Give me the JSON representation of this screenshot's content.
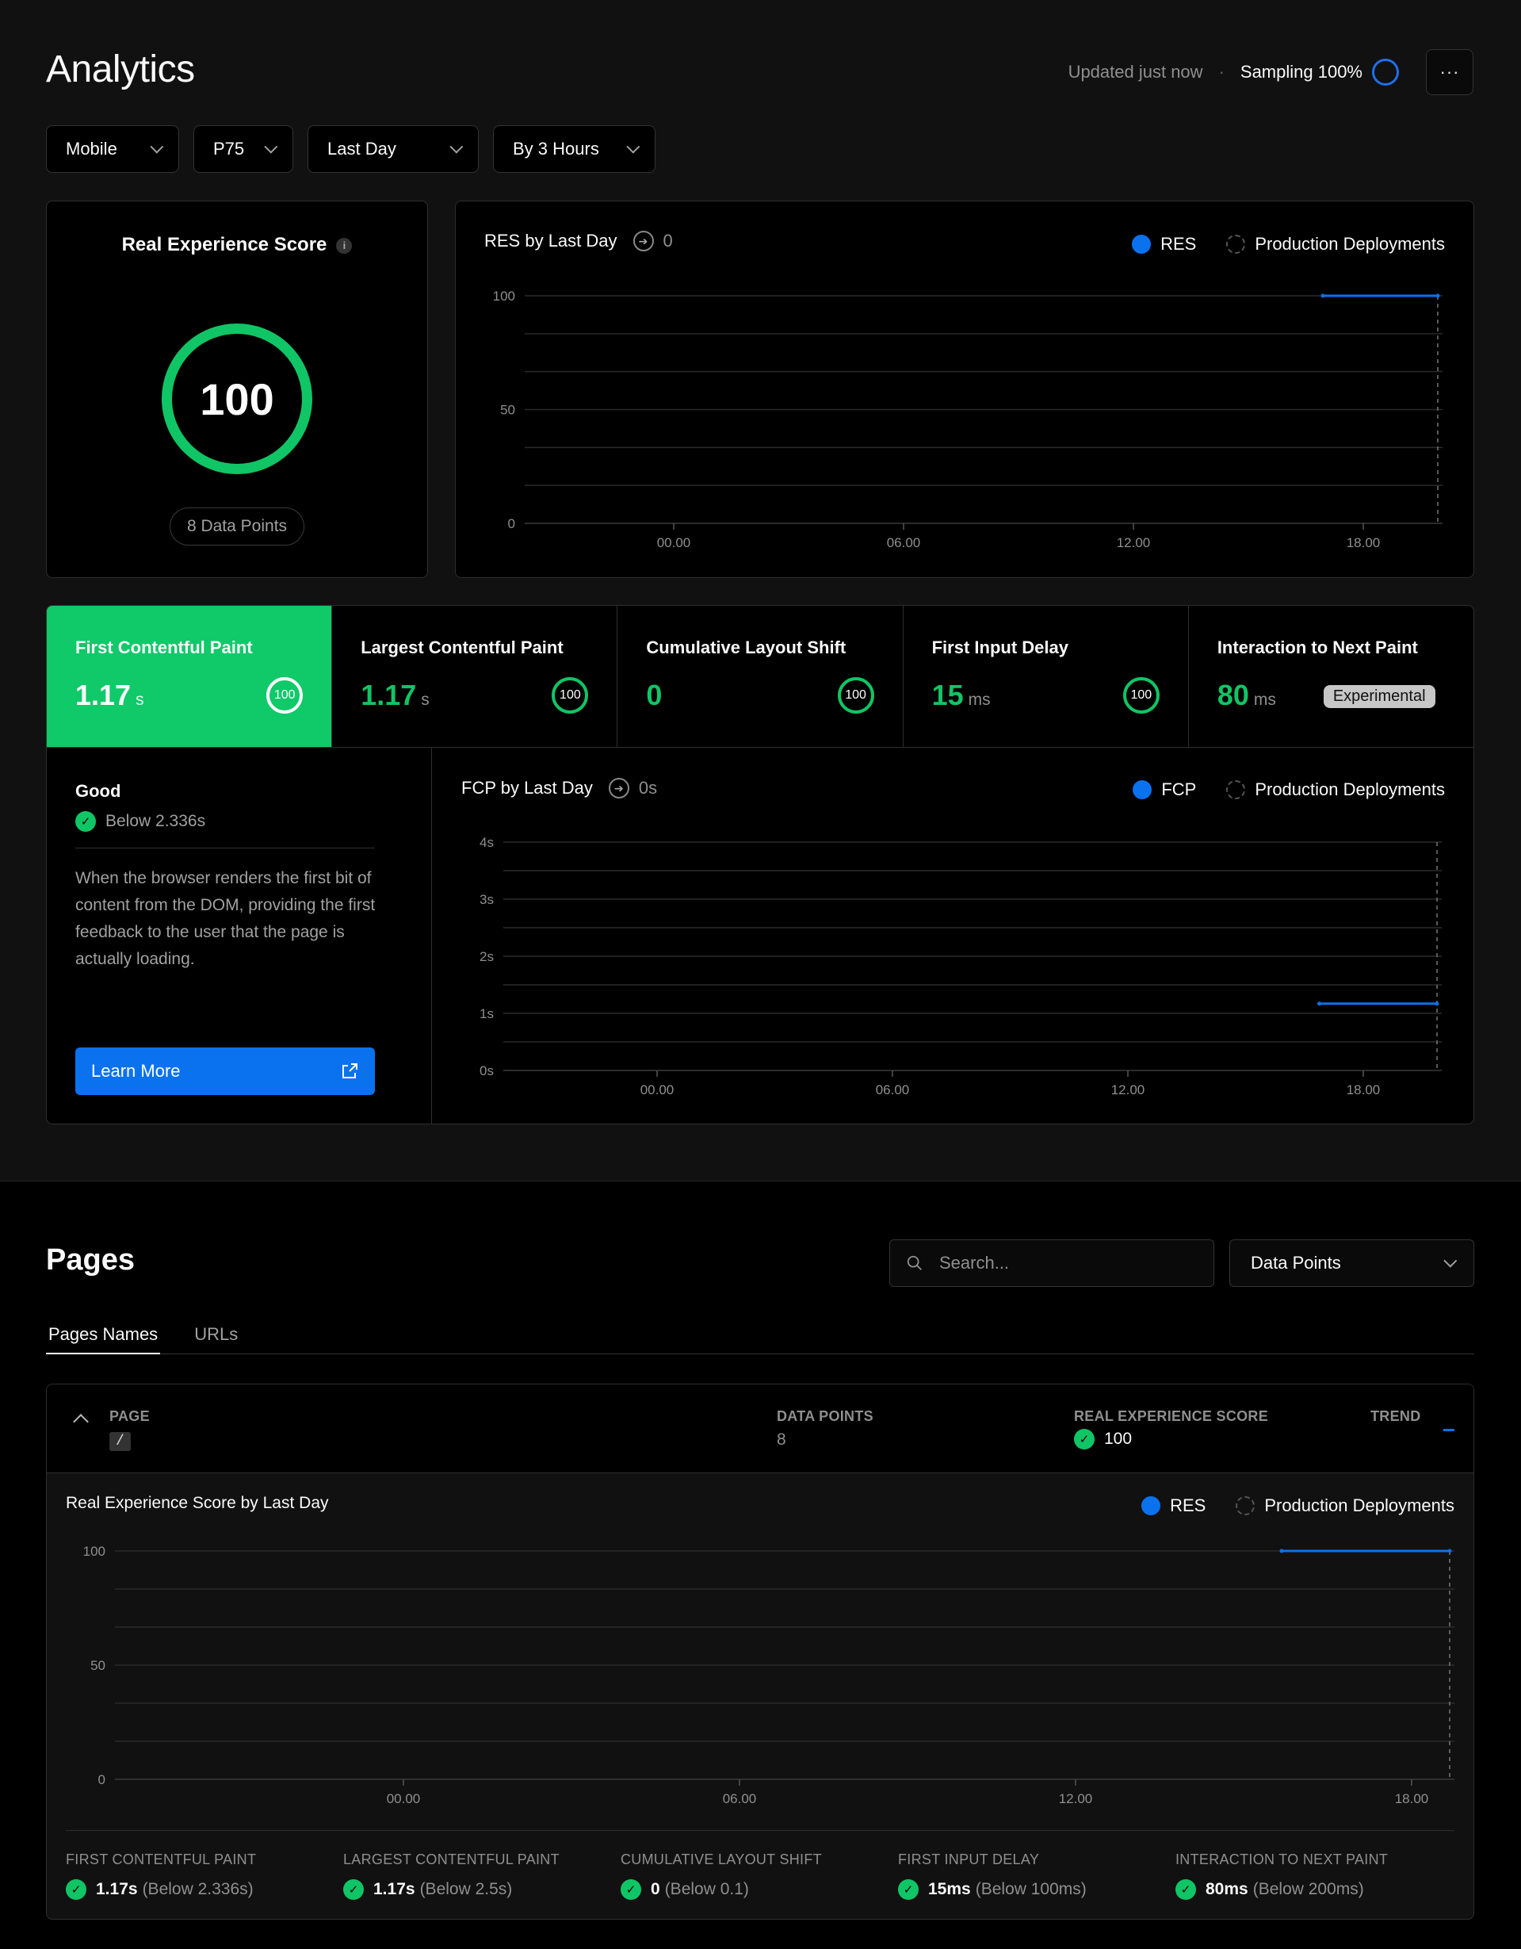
{
  "header": {
    "title": "Analytics",
    "updated": "Updated just now",
    "separator": "·",
    "sampling": "Sampling 100%",
    "more_label": "···"
  },
  "filters": [
    {
      "label": "Mobile"
    },
    {
      "label": "P75"
    },
    {
      "label": "Last Day"
    },
    {
      "label": "By 3 Hours"
    }
  ],
  "res_card": {
    "title": "Real Experience Score",
    "info_icon": "i",
    "score": "100",
    "data_points": "8 Data Points"
  },
  "res_chart": {
    "title": "RES by Last Day",
    "change": "0",
    "legend_primary": "RES",
    "legend_secondary": "Production Deployments"
  },
  "metrics": [
    {
      "name": "First Contentful Paint",
      "value": "1.17",
      "unit": "s",
      "score": "100",
      "active": true
    },
    {
      "name": "Largest Contentful Paint",
      "value": "1.17",
      "unit": "s",
      "score": "100"
    },
    {
      "name": "Cumulative Layout Shift",
      "value": "0",
      "unit": "",
      "score": "100"
    },
    {
      "name": "First Input Delay",
      "value": "15",
      "unit": "ms",
      "score": "100"
    },
    {
      "name": "Interaction to Next Paint",
      "value": "80",
      "unit": "ms",
      "badge": "Experimental"
    }
  ],
  "detail": {
    "rating": "Good",
    "threshold": "Below 2.336s",
    "description": "When the browser renders the first bit of content from the DOM, providing the first feedback to the user that the page is actually loading.",
    "learn_more": "Learn More"
  },
  "fcp_chart": {
    "title": "FCP by Last Day",
    "change": "0s",
    "legend_primary": "FCP",
    "legend_secondary": "Production Deployments"
  },
  "pages": {
    "title": "Pages",
    "search_placeholder": "Search...",
    "sort_select": "Data Points",
    "tabs": [
      {
        "label": "Pages Names",
        "active": true
      },
      {
        "label": "URLs"
      }
    ],
    "columns": {
      "page": "PAGE",
      "data_points": "DATA POINTS",
      "res": "REAL EXPERIENCE SCORE",
      "trend": "TREND"
    },
    "row": {
      "page": "/",
      "data_points": "8",
      "res": "100"
    },
    "chart_title": "Real Experience Score by Last Day",
    "legend_primary": "RES",
    "legend_secondary": "Production Deployments",
    "metrics": [
      {
        "label": "FIRST CONTENTFUL PAINT",
        "value": "1.17s",
        "threshold": "(Below 2.336s)"
      },
      {
        "label": "LARGEST CONTENTFUL PAINT",
        "value": "1.17s",
        "threshold": "(Below 2.5s)"
      },
      {
        "label": "CUMULATIVE LAYOUT SHIFT",
        "value": "0",
        "threshold": "(Below 0.1)"
      },
      {
        "label": "FIRST INPUT DELAY",
        "value": "15ms",
        "threshold": "(Below 100ms)"
      },
      {
        "label": "INTERACTION TO NEXT PAINT",
        "value": "80ms",
        "threshold": "(Below 200ms)"
      }
    ]
  },
  "colors": {
    "accent": "#0a72ef",
    "good": "#10c565",
    "active_metric_bg": "#10c969"
  },
  "chart_data": [
    {
      "type": "line",
      "title": "RES by Last Day",
      "x_ticks": [
        "00.00",
        "06.00",
        "12.00",
        "18.00"
      ],
      "y_ticks": [
        "0",
        "50",
        "100"
      ],
      "ylim": [
        0,
        100
      ],
      "series": [
        {
          "name": "RES",
          "x": [
            "21:00",
            "24:00"
          ],
          "values": [
            100,
            100
          ]
        }
      ],
      "deployment_marker_x": "24:00",
      "grid": true,
      "legend": "top-right"
    },
    {
      "type": "line",
      "title": "FCP by Last Day",
      "x_ticks": [
        "00.00",
        "06.00",
        "12.00",
        "18.00"
      ],
      "y_ticks": [
        "0s",
        "1s",
        "2s",
        "3s",
        "4s"
      ],
      "ylim": [
        0,
        4
      ],
      "series": [
        {
          "name": "FCP",
          "x": [
            "21:00",
            "24:00"
          ],
          "values": [
            1.17,
            1.17
          ]
        }
      ],
      "deployment_marker_x": "24:00",
      "grid": true,
      "legend": "top-right"
    },
    {
      "type": "line",
      "title": "Real Experience Score by Last Day",
      "x_ticks": [
        "00.00",
        "06.00",
        "12.00",
        "18.00"
      ],
      "y_ticks": [
        "0",
        "50",
        "100"
      ],
      "ylim": [
        0,
        100
      ],
      "series": [
        {
          "name": "RES",
          "x": [
            "21:00",
            "24:00"
          ],
          "values": [
            100,
            100
          ]
        }
      ],
      "deployment_marker_x": "24:00",
      "grid": true,
      "legend": "top-right"
    }
  ]
}
